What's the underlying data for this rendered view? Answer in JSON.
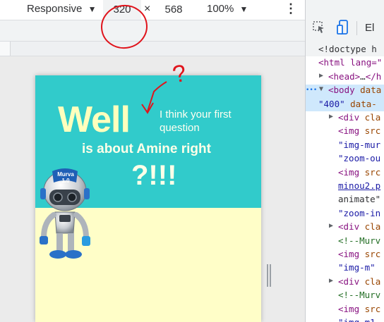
{
  "toolbar": {
    "device_mode": "Responsive",
    "width": "320",
    "times": "×",
    "height": "568",
    "zoom": "100%",
    "more": "⋮"
  },
  "devtools": {
    "tab_label": "El",
    "lines": [
      {
        "indent": 20,
        "parts": [
          {
            "t": "<!doctype h",
            "c": "plain"
          }
        ]
      },
      {
        "indent": 20,
        "parts": [
          {
            "t": "<html lang=\"",
            "c": "tag"
          }
        ]
      },
      {
        "indent": 34,
        "arrow": "▶",
        "parts": [
          {
            "t": "<head>",
            "c": "tag"
          },
          {
            "t": "…",
            "c": "plain"
          },
          {
            "t": "</h",
            "c": "tag"
          }
        ]
      },
      {
        "indent": 34,
        "arrow": "▼",
        "dots": "•••",
        "parts": [
          {
            "t": "<body ",
            "c": "tag"
          },
          {
            "t": "data",
            "c": "attr"
          }
        ]
      },
      {
        "indent": 20,
        "parts": [
          {
            "t": "\"400\" ",
            "c": "val"
          },
          {
            "t": "data-",
            "c": "attr"
          }
        ]
      },
      {
        "indent": 48,
        "arrow": "▶",
        "parts": [
          {
            "t": "<div ",
            "c": "tag"
          },
          {
            "t": "cla",
            "c": "attr"
          }
        ]
      },
      {
        "indent": 48,
        "parts": [
          {
            "t": "<img ",
            "c": "tag"
          },
          {
            "t": "src",
            "c": "attr"
          }
        ]
      },
      {
        "indent": 48,
        "parts": [
          {
            "t": "\"img-mur",
            "c": "val"
          }
        ]
      },
      {
        "indent": 48,
        "parts": [
          {
            "t": "\"zoom-ou",
            "c": "val"
          }
        ]
      },
      {
        "indent": 48,
        "parts": [
          {
            "t": "<img ",
            "c": "tag"
          },
          {
            "t": "src",
            "c": "attr"
          }
        ]
      },
      {
        "indent": 48,
        "parts": [
          {
            "t": "minou2.p",
            "c": "link"
          }
        ]
      },
      {
        "indent": 48,
        "parts": [
          {
            "t": "animate\"",
            "c": "plain"
          }
        ]
      },
      {
        "indent": 48,
        "parts": [
          {
            "t": "\"zoom-in",
            "c": "val"
          }
        ]
      },
      {
        "indent": 48,
        "arrow": "▶",
        "parts": [
          {
            "t": "<div ",
            "c": "tag"
          },
          {
            "t": "cla",
            "c": "attr"
          }
        ]
      },
      {
        "indent": 48,
        "parts": [
          {
            "t": "<!--Murv",
            "c": "cmt"
          }
        ]
      },
      {
        "indent": 48,
        "parts": [
          {
            "t": "<img ",
            "c": "tag"
          },
          {
            "t": "src",
            "c": "attr"
          }
        ]
      },
      {
        "indent": 48,
        "parts": [
          {
            "t": "\"img-m\"",
            "c": "val"
          }
        ]
      },
      {
        "indent": 48,
        "arrow": "▶",
        "parts": [
          {
            "t": "<div ",
            "c": "tag"
          },
          {
            "t": "cla",
            "c": "attr"
          }
        ]
      },
      {
        "indent": 48,
        "parts": [
          {
            "t": "<!--Murv",
            "c": "cmt"
          }
        ]
      },
      {
        "indent": 48,
        "parts": [
          {
            "t": "<img ",
            "c": "tag"
          },
          {
            "t": "src",
            "c": "attr"
          }
        ]
      },
      {
        "indent": 48,
        "parts": [
          {
            "t": "\"img-m1",
            "c": "val"
          }
        ]
      }
    ]
  },
  "page": {
    "well": "Well",
    "side_text_1": "I think your first",
    "side_text_2": "question",
    "subtitle": "is about Amine right",
    "exclaim": "?!!!",
    "robot_badge_1": "Murva",
    "robot_badge_2": "1.0"
  },
  "annotations": {
    "question_mark": "?",
    "color": "#e0141c"
  },
  "colors": {
    "hero_bg": "#31cbcb",
    "page_bg": "#fffec8",
    "hero_text": "#ffffbd",
    "selection": "#cfe8fc"
  }
}
